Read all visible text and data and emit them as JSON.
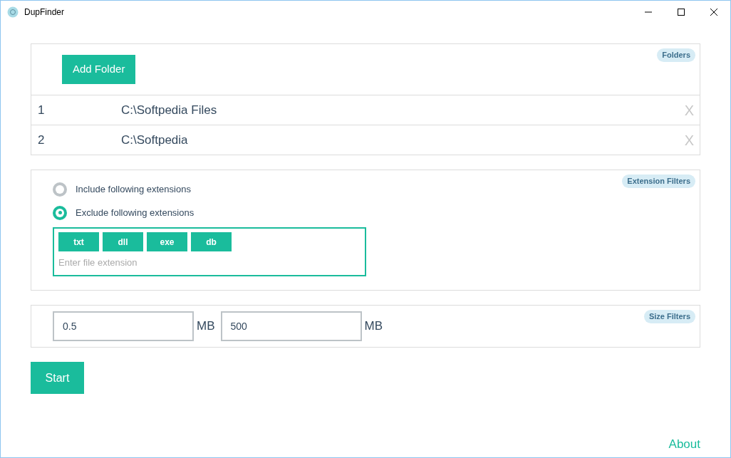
{
  "window": {
    "title": "DupFinder"
  },
  "folders": {
    "badge": "Folders",
    "add_button": "Add Folder",
    "rows": [
      {
        "index": "1",
        "path": "C:\\Softpedia Files",
        "remove": "X"
      },
      {
        "index": "2",
        "path": "C:\\Softpedia",
        "remove": "X"
      }
    ]
  },
  "extension_filters": {
    "badge": "Extension Filters",
    "options": [
      {
        "label": "Include following extensions",
        "selected": false
      },
      {
        "label": "Exclude following extensions",
        "selected": true
      }
    ],
    "tags": [
      "txt",
      "dll",
      "exe",
      "db"
    ],
    "placeholder": "Enter file extension"
  },
  "size_filters": {
    "badge": "Size Filters",
    "min": "0.5",
    "min_unit": "MB",
    "max": "500",
    "max_unit": "MB"
  },
  "start_button": "Start",
  "about_link": "About"
}
